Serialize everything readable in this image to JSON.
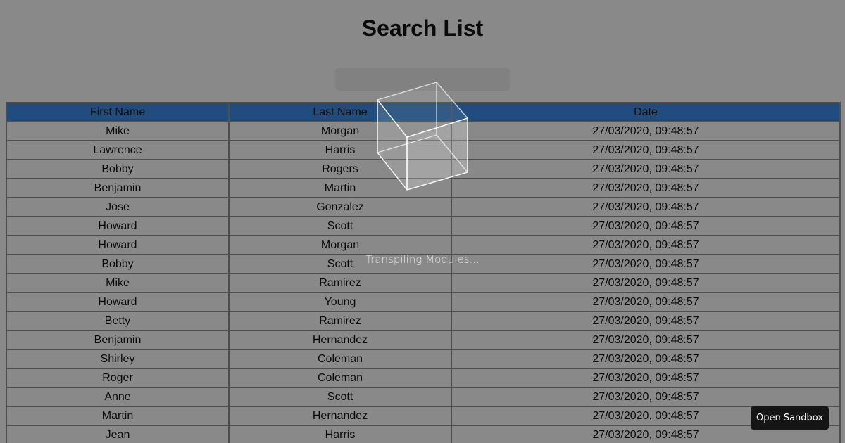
{
  "page": {
    "title": "Search List"
  },
  "search": {
    "value": "",
    "placeholder": ""
  },
  "table": {
    "columns": [
      "First Name",
      "Last Name",
      "Date"
    ],
    "rows": [
      [
        "Mike",
        "Morgan",
        "27/03/2020, 09:48:57"
      ],
      [
        "Lawrence",
        "Harris",
        "27/03/2020, 09:48:57"
      ],
      [
        "Bobby",
        "Rogers",
        "27/03/2020, 09:48:57"
      ],
      [
        "Benjamin",
        "Martin",
        "27/03/2020, 09:48:57"
      ],
      [
        "Jose",
        "Gonzalez",
        "27/03/2020, 09:48:57"
      ],
      [
        "Howard",
        "Scott",
        "27/03/2020, 09:48:57"
      ],
      [
        "Howard",
        "Morgan",
        "27/03/2020, 09:48:57"
      ],
      [
        "Bobby",
        "Scott",
        "27/03/2020, 09:48:57"
      ],
      [
        "Mike",
        "Ramirez",
        "27/03/2020, 09:48:57"
      ],
      [
        "Howard",
        "Young",
        "27/03/2020, 09:48:57"
      ],
      [
        "Betty",
        "Ramirez",
        "27/03/2020, 09:48:57"
      ],
      [
        "Benjamin",
        "Hernandez",
        "27/03/2020, 09:48:57"
      ],
      [
        "Shirley",
        "Coleman",
        "27/03/2020, 09:48:57"
      ],
      [
        "Roger",
        "Coleman",
        "27/03/2020, 09:48:57"
      ],
      [
        "Anne",
        "Scott",
        "27/03/2020, 09:48:57"
      ],
      [
        "Martin",
        "Hernandez",
        "27/03/2020, 09:48:57"
      ],
      [
        "Jean",
        "Harris",
        "27/03/2020, 09:48:57"
      ]
    ]
  },
  "overlay": {
    "loading_text": "Transpiling Modules...",
    "icon": "cube-icon"
  },
  "sandbox_button": {
    "label": "Open Sandbox"
  },
  "colors": {
    "header_bg": "#2d87e6",
    "overlay": "rgba(20,20,20,0.5)",
    "button_bg": "#151515"
  }
}
